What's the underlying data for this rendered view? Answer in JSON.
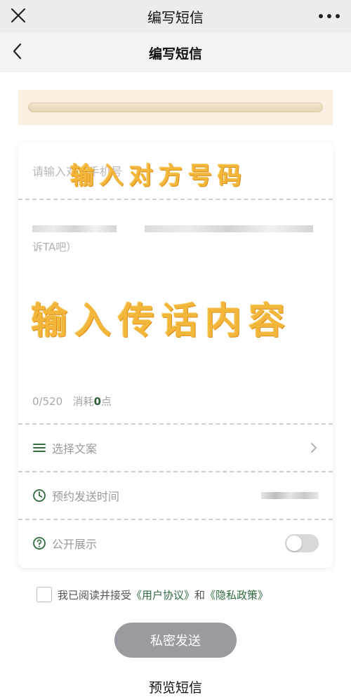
{
  "window": {
    "title": "编写短信"
  },
  "header": {
    "title": "编写短信"
  },
  "form": {
    "phone_placeholder": "请输入对方手机号",
    "phone_overlay": "输入对方号码",
    "message_hint": "诉TA吧）",
    "message_overlay": "输入传话内容",
    "counter_value": "0/520",
    "cost_prefix": "消耗",
    "cost_number": "0",
    "cost_unit": "点",
    "select_template_label": "选择文案",
    "schedule_label": "预约发送时间",
    "public_label": "公开展示",
    "public_enabled": false
  },
  "agreement": {
    "prefix": "我已阅读并接受",
    "user_agreement": "《用户协议》",
    "and": "和",
    "privacy_policy": "《隐私政策》",
    "checked": false
  },
  "actions": {
    "send_label": "私密发送",
    "preview_label": "预览短信"
  },
  "colors": {
    "accent_green": "#2f6b3e",
    "send_button": "#9a9ba0",
    "overlay_text": "#f2b63a"
  },
  "icons": [
    "close-icon",
    "more-icon",
    "back-icon",
    "list-icon",
    "clock-icon",
    "question-icon",
    "chevron-right-icon"
  ]
}
